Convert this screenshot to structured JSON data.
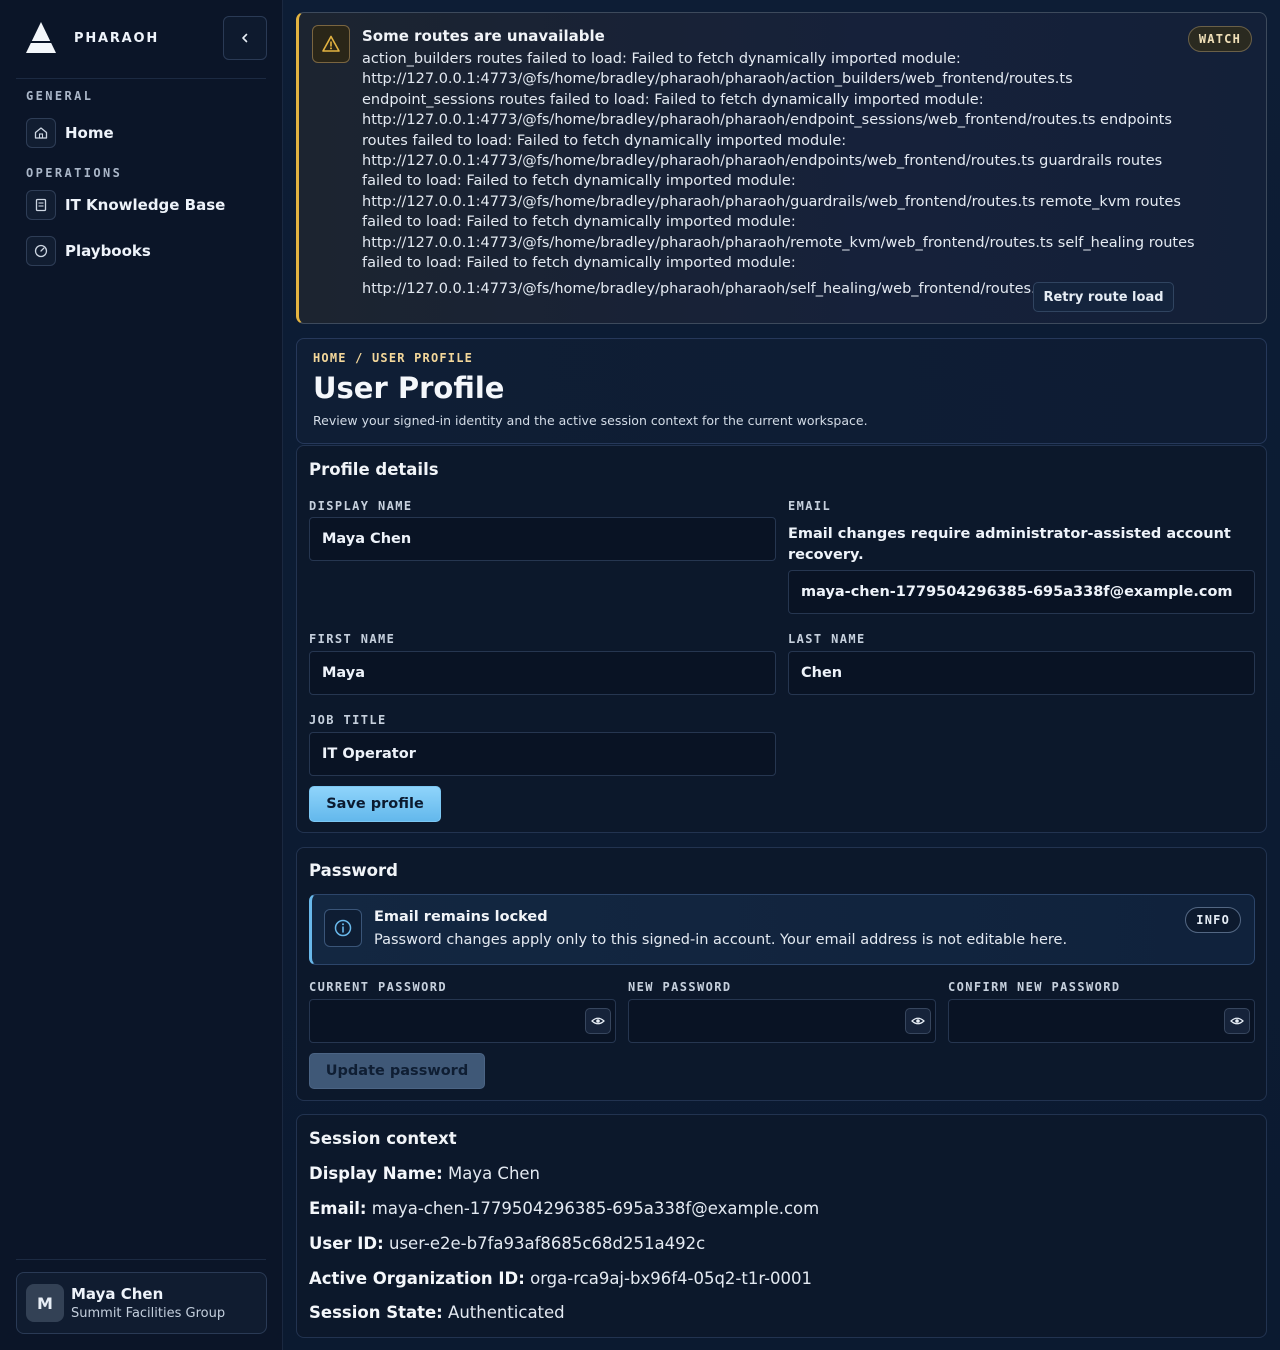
{
  "sidebar": {
    "brand": "PHARAOH",
    "sections": [
      {
        "title": "GENERAL",
        "items": [
          {
            "label": "Home",
            "icon": "home-icon"
          }
        ]
      },
      {
        "title": "OPERATIONS",
        "items": [
          {
            "label": "IT Knowledge Base",
            "icon": "book-icon"
          },
          {
            "label": "Playbooks",
            "icon": "gauge-icon"
          }
        ]
      }
    ],
    "user": {
      "initial": "M",
      "name": "Maya Chen",
      "org": "Summit Facilities Group"
    }
  },
  "alert": {
    "title": "Some routes are unavailable",
    "badge": "WATCH",
    "body": "action_builders routes failed to load: Failed to fetch dynamically imported module: http://127.0.0.1:4773/@fs/home/bradley/pharaoh/pharaoh/action_builders/web_frontend/routes.ts endpoint_sessions routes failed to load: Failed to fetch dynamically imported module: http://127.0.0.1:4773/@fs/home/bradley/pharaoh/pharaoh/endpoint_sessions/web_frontend/routes.ts endpoints routes failed to load: Failed to fetch dynamically imported module: http://127.0.0.1:4773/@fs/home/bradley/pharaoh/pharaoh/endpoints/web_frontend/routes.ts guardrails routes failed to load: Failed to fetch dynamically imported module: http://127.0.0.1:4773/@fs/home/bradley/pharaoh/pharaoh/guardrails/web_frontend/routes.ts remote_kvm routes failed to load: Failed to fetch dynamically imported module: http://127.0.0.1:4773/@fs/home/bradley/pharaoh/pharaoh/remote_kvm/web_frontend/routes.ts self_healing routes failed to load: Failed to fetch dynamically imported module:",
    "last_line": "http://127.0.0.1:4773/@fs/home/bradley/pharaoh/pharaoh/self_healing/web_frontend/routes.ts",
    "retry_label": "Retry route load",
    "accent": "#e3b341"
  },
  "header": {
    "breadcrumb": "HOME / USER PROFILE",
    "title": "User Profile",
    "subtitle": "Review your signed-in identity and the active session context for the current workspace."
  },
  "profile": {
    "title": "Profile details",
    "display_name_label": "DISPLAY NAME",
    "display_name": "Maya Chen",
    "email_label": "EMAIL",
    "email_note": "Email changes require administrator-assisted account recovery.",
    "email": "maya-chen-1779504296385-695a338f@example.com",
    "first_name_label": "FIRST NAME",
    "first_name": "Maya",
    "last_name_label": "LAST NAME",
    "last_name": "Chen",
    "job_title_label": "JOB TITLE",
    "job_title": "IT Operator",
    "save_label": "Save profile"
  },
  "password": {
    "title": "Password",
    "info_title": "Email remains locked",
    "info_text": "Password changes apply only to this signed-in account. Your email address is not editable here.",
    "info_badge": "INFO",
    "current_label": "CURRENT PASSWORD",
    "new_label": "NEW PASSWORD",
    "confirm_label": "CONFIRM NEW PASSWORD",
    "current_value": "",
    "new_value": "",
    "confirm_value": "",
    "update_label": "Update password",
    "accent": "#69b8ea"
  },
  "session": {
    "title": "Session context",
    "rows": [
      {
        "key": "Display Name:",
        "value": "Maya Chen"
      },
      {
        "key": "Email:",
        "value": "maya-chen-1779504296385-695a338f@example.com"
      },
      {
        "key": "User ID:",
        "value": "user-e2e-b7fa93af8685c68d251a492c"
      },
      {
        "key": "Active Organization ID:",
        "value": "orga-rca9aj-bx96f4-05q2-t1r-0001"
      },
      {
        "key": "Session State:",
        "value": "Authenticated"
      }
    ]
  }
}
